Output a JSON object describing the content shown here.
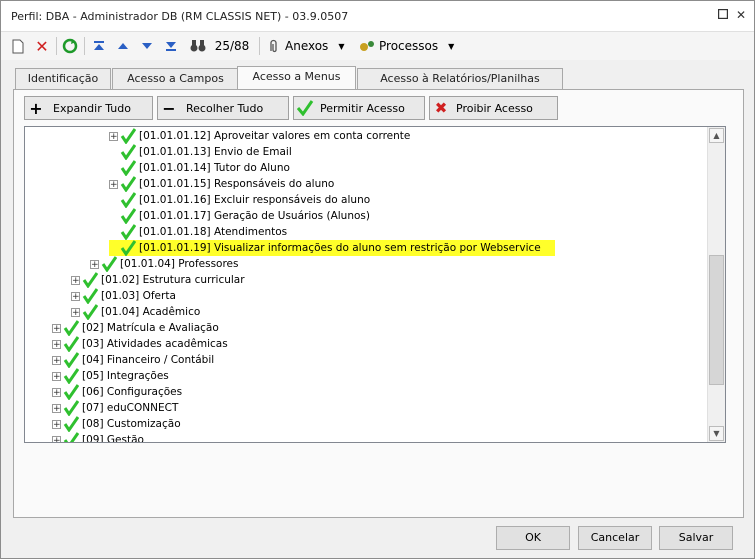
{
  "window": {
    "title": "Perfil: DBA - Administrador DB (RM CLASSIS NET) - 03.9.0507"
  },
  "toolbar": {
    "record_counter": "25/88",
    "anexos_label": "Anexos",
    "processos_label": "Processos"
  },
  "tabs": [
    {
      "label": "Identificação"
    },
    {
      "label": "Acesso a Campos"
    },
    {
      "label": "Acesso a Menus"
    },
    {
      "label": "Acesso à Relatórios/Planilhas"
    }
  ],
  "actions": {
    "expand": "Expandir Tudo",
    "collapse": "Recolher Tudo",
    "allow": "Permitir Acesso",
    "deny": "Proibir Acesso"
  },
  "tree": [
    {
      "label": "[01.01.01.12] Aproveitar valores em conta corrente",
      "level": 3,
      "expander": true,
      "highlight": false
    },
    {
      "label": "[01.01.01.13] Envio de Email",
      "level": 3,
      "expander": false,
      "highlight": false
    },
    {
      "label": "[01.01.01.14] Tutor do Aluno",
      "level": 3,
      "expander": false,
      "highlight": false
    },
    {
      "label": "[01.01.01.15] Responsáveis do aluno",
      "level": 3,
      "expander": true,
      "highlight": false
    },
    {
      "label": "[01.01.01.16] Excluir responsáveis do aluno",
      "level": 3,
      "expander": false,
      "highlight": false
    },
    {
      "label": "[01.01.01.17] Geração de Usuários (Alunos)",
      "level": 3,
      "expander": false,
      "highlight": false
    },
    {
      "label": "[01.01.01.18] Atendimentos",
      "level": 3,
      "expander": false,
      "highlight": false
    },
    {
      "label": "[01.01.01.19] Visualizar informações do aluno sem restrição por Webservice",
      "level": 3,
      "expander": false,
      "highlight": true
    },
    {
      "label": "[01.01.04] Professores",
      "level": 2,
      "expander": true,
      "highlight": false
    },
    {
      "label": "[01.02] Estrutura curricular",
      "level": 1,
      "expander": true,
      "highlight": false
    },
    {
      "label": "[01.03] Oferta",
      "level": 1,
      "expander": true,
      "highlight": false
    },
    {
      "label": "[01.04] Acadêmico",
      "level": 1,
      "expander": true,
      "highlight": false
    },
    {
      "label": "[02] Matrícula e Avaliação",
      "level": 0,
      "expander": true,
      "highlight": false
    },
    {
      "label": "[03] Atividades acadêmicas",
      "level": 0,
      "expander": true,
      "highlight": false
    },
    {
      "label": "[04] Financeiro / Contábil",
      "level": 0,
      "expander": true,
      "highlight": false
    },
    {
      "label": "[05] Integrações",
      "level": 0,
      "expander": true,
      "highlight": false
    },
    {
      "label": "[06] Configurações",
      "level": 0,
      "expander": true,
      "highlight": false
    },
    {
      "label": "[07] eduCONNECT",
      "level": 0,
      "expander": true,
      "highlight": false
    },
    {
      "label": "[08] Customização",
      "level": 0,
      "expander": true,
      "highlight": false
    },
    {
      "label": "[09] Gestão",
      "level": 0,
      "expander": true,
      "highlight": false
    }
  ],
  "footer": {
    "ok": "OK",
    "cancel": "Cancelar",
    "save": "Salvar"
  },
  "colors": {
    "highlight": "#ffff2a",
    "check": "#2fc02f"
  }
}
